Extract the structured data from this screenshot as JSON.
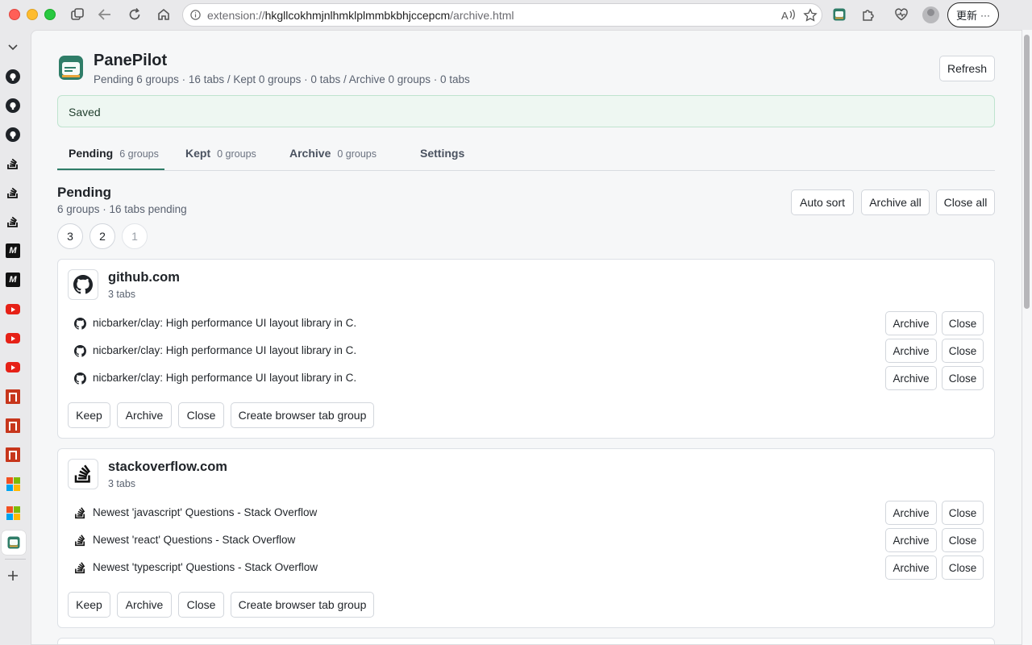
{
  "browser": {
    "url_prefix": "extension://",
    "url_host": "hkgllcokhmjnlhmklplmmbkbhjccepcm",
    "url_path": "/archive.html",
    "update_label": "更新",
    "more_label": "···"
  },
  "app": {
    "title": "PanePilot",
    "summary": "Pending 6 groups · 16 tabs / Kept 0 groups · 0 tabs / Archive 0 groups · 0 tabs",
    "refresh_label": "Refresh",
    "saved_message": "Saved"
  },
  "tabs": [
    {
      "label": "Pending",
      "count": "6 groups"
    },
    {
      "label": "Kept",
      "count": "0 groups"
    },
    {
      "label": "Archive",
      "count": "0 groups"
    },
    {
      "label": "Settings",
      "count": ""
    }
  ],
  "section": {
    "title": "Pending",
    "subtitle": "6 groups · 16 tabs pending",
    "auto_sort_label": "Auto sort",
    "archive_all_label": "Archive all",
    "close_all_label": "Close all",
    "pages": [
      "3",
      "2",
      "1"
    ]
  },
  "groups": [
    {
      "domain": "github.com",
      "count": "3 tabs",
      "icon": "github-icon",
      "tabs": [
        "nicbarker/clay: High performance UI layout library in C.",
        "nicbarker/clay: High performance UI layout library in C.",
        "nicbarker/clay: High performance UI layout library in C."
      ]
    },
    {
      "domain": "stackoverflow.com",
      "count": "3 tabs",
      "icon": "stackoverflow-icon",
      "tabs": [
        "Newest 'javascript' Questions - Stack Overflow",
        "Newest 'react' Questions - Stack Overflow",
        "Newest 'typescript' Questions - Stack Overflow"
      ]
    }
  ],
  "row_actions": {
    "archive": "Archive",
    "close": "Close"
  },
  "group_actions": {
    "keep": "Keep",
    "archive": "Archive",
    "close": "Close",
    "create_group": "Create browser tab group"
  },
  "colors": {
    "accent": "#2f7d68",
    "saved_bg": "#eef7f2"
  }
}
